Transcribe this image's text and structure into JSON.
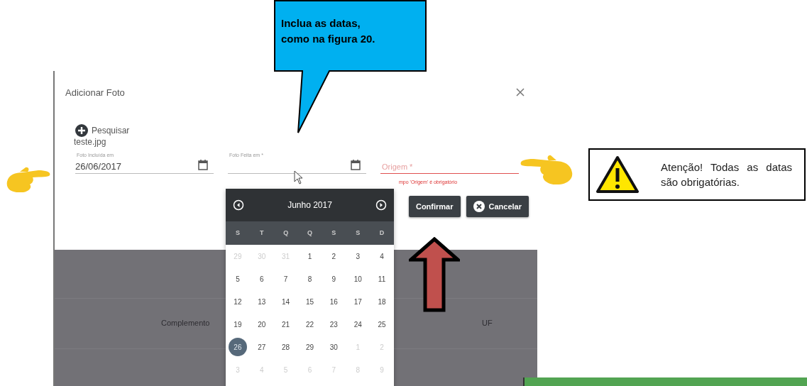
{
  "callout": {
    "text": "Inclua as datas, como na figura 20."
  },
  "note": {
    "text": "Atenção! Todas as datas são obrigatórias."
  },
  "dialog": {
    "title": "Adicionar Foto",
    "upload": {
      "label": "Pesquisar",
      "file": "teste.jpg"
    },
    "fields": [
      {
        "kind": "date",
        "label": "Foto Incluída em",
        "value": "26/06/2017",
        "invalid": false
      },
      {
        "kind": "date",
        "label": "Foto Feita em *",
        "invalid": false
      },
      {
        "kind": "text",
        "placeholder": "Origem *",
        "invalid": true,
        "error": "mpo 'Origem' é obrigatório"
      }
    ],
    "buttons": [
      {
        "kind": "confirm",
        "label": "Confirmar"
      },
      {
        "kind": "cancel",
        "label": "Cancelar"
      }
    ]
  },
  "calendar": {
    "month": "Junho 2017",
    "weekdays": [
      "S",
      "T",
      "Q",
      "Q",
      "S",
      "S",
      "D"
    ],
    "days": [
      {
        "label": "29",
        "outside": true,
        "selected": false
      },
      {
        "label": "30",
        "outside": true,
        "selected": false
      },
      {
        "label": "31",
        "outside": true,
        "selected": false
      },
      {
        "label": "1",
        "outside": false,
        "selected": false
      },
      {
        "label": "2",
        "outside": false,
        "selected": false
      },
      {
        "label": "3",
        "outside": false,
        "selected": false
      },
      {
        "label": "4",
        "outside": false,
        "selected": false
      },
      {
        "label": "5",
        "outside": false,
        "selected": false
      },
      {
        "label": "6",
        "outside": false,
        "selected": false
      },
      {
        "label": "7",
        "outside": false,
        "selected": false
      },
      {
        "label": "8",
        "outside": false,
        "selected": false
      },
      {
        "label": "9",
        "outside": false,
        "selected": false
      },
      {
        "label": "10",
        "outside": false,
        "selected": false
      },
      {
        "label": "11",
        "outside": false,
        "selected": false
      },
      {
        "label": "12",
        "outside": false,
        "selected": false
      },
      {
        "label": "13",
        "outside": false,
        "selected": false
      },
      {
        "label": "14",
        "outside": false,
        "selected": false
      },
      {
        "label": "15",
        "outside": false,
        "selected": false
      },
      {
        "label": "16",
        "outside": false,
        "selected": false
      },
      {
        "label": "17",
        "outside": false,
        "selected": false
      },
      {
        "label": "18",
        "outside": false,
        "selected": false
      },
      {
        "label": "19",
        "outside": false,
        "selected": false
      },
      {
        "label": "20",
        "outside": false,
        "selected": false
      },
      {
        "label": "21",
        "outside": false,
        "selected": false
      },
      {
        "label": "22",
        "outside": false,
        "selected": false
      },
      {
        "label": "23",
        "outside": false,
        "selected": false
      },
      {
        "label": "24",
        "outside": false,
        "selected": false
      },
      {
        "label": "25",
        "outside": false,
        "selected": false
      },
      {
        "label": "26",
        "outside": false,
        "selected": true
      },
      {
        "label": "27",
        "outside": false,
        "selected": false
      },
      {
        "label": "28",
        "outside": false,
        "selected": false
      },
      {
        "label": "29",
        "outside": false,
        "selected": false
      },
      {
        "label": "30",
        "outside": false,
        "selected": false
      },
      {
        "label": "1",
        "outside": true,
        "selected": false
      },
      {
        "label": "2",
        "outside": true,
        "selected": false
      },
      {
        "label": "3",
        "outside": true,
        "selected": false
      },
      {
        "label": "4",
        "outside": true,
        "selected": false
      },
      {
        "label": "5",
        "outside": true,
        "selected": false
      },
      {
        "label": "6",
        "outside": true,
        "selected": false
      },
      {
        "label": "7",
        "outside": true,
        "selected": false
      },
      {
        "label": "8",
        "outside": true,
        "selected": false
      },
      {
        "label": "9",
        "outside": true,
        "selected": false
      }
    ]
  },
  "table": {
    "columns": [
      "Complemento",
      "UF"
    ]
  }
}
